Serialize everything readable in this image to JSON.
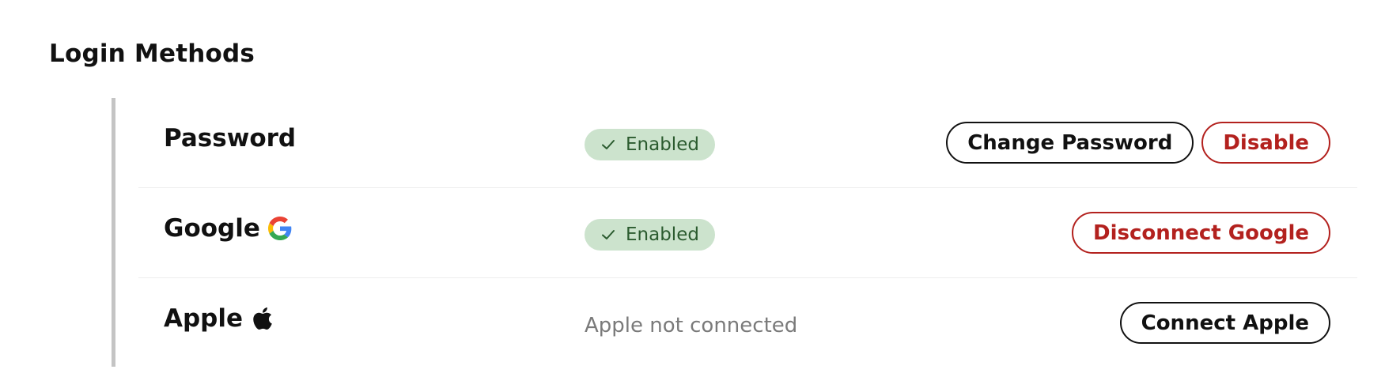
{
  "section": {
    "title": "Login Methods"
  },
  "methods": [
    {
      "name": "Password",
      "status": "Enabled",
      "actions": [
        {
          "label": "Change Password",
          "style": "default"
        },
        {
          "label": "Disable",
          "style": "danger"
        }
      ]
    },
    {
      "name": "Google",
      "icon": "google-icon",
      "status": "Enabled",
      "actions": [
        {
          "label": "Disconnect Google",
          "style": "danger"
        }
      ]
    },
    {
      "name": "Apple",
      "icon": "apple-icon",
      "status": "Apple not connected",
      "actions": [
        {
          "label": "Connect Apple",
          "style": "default"
        }
      ]
    }
  ],
  "colors": {
    "enabled_badge_bg": "#cce3cd",
    "enabled_badge_text": "#2b5b2f",
    "danger": "#b3211e",
    "muted_text": "#7a7a7a",
    "divider_rail": "#c4c4c4"
  }
}
